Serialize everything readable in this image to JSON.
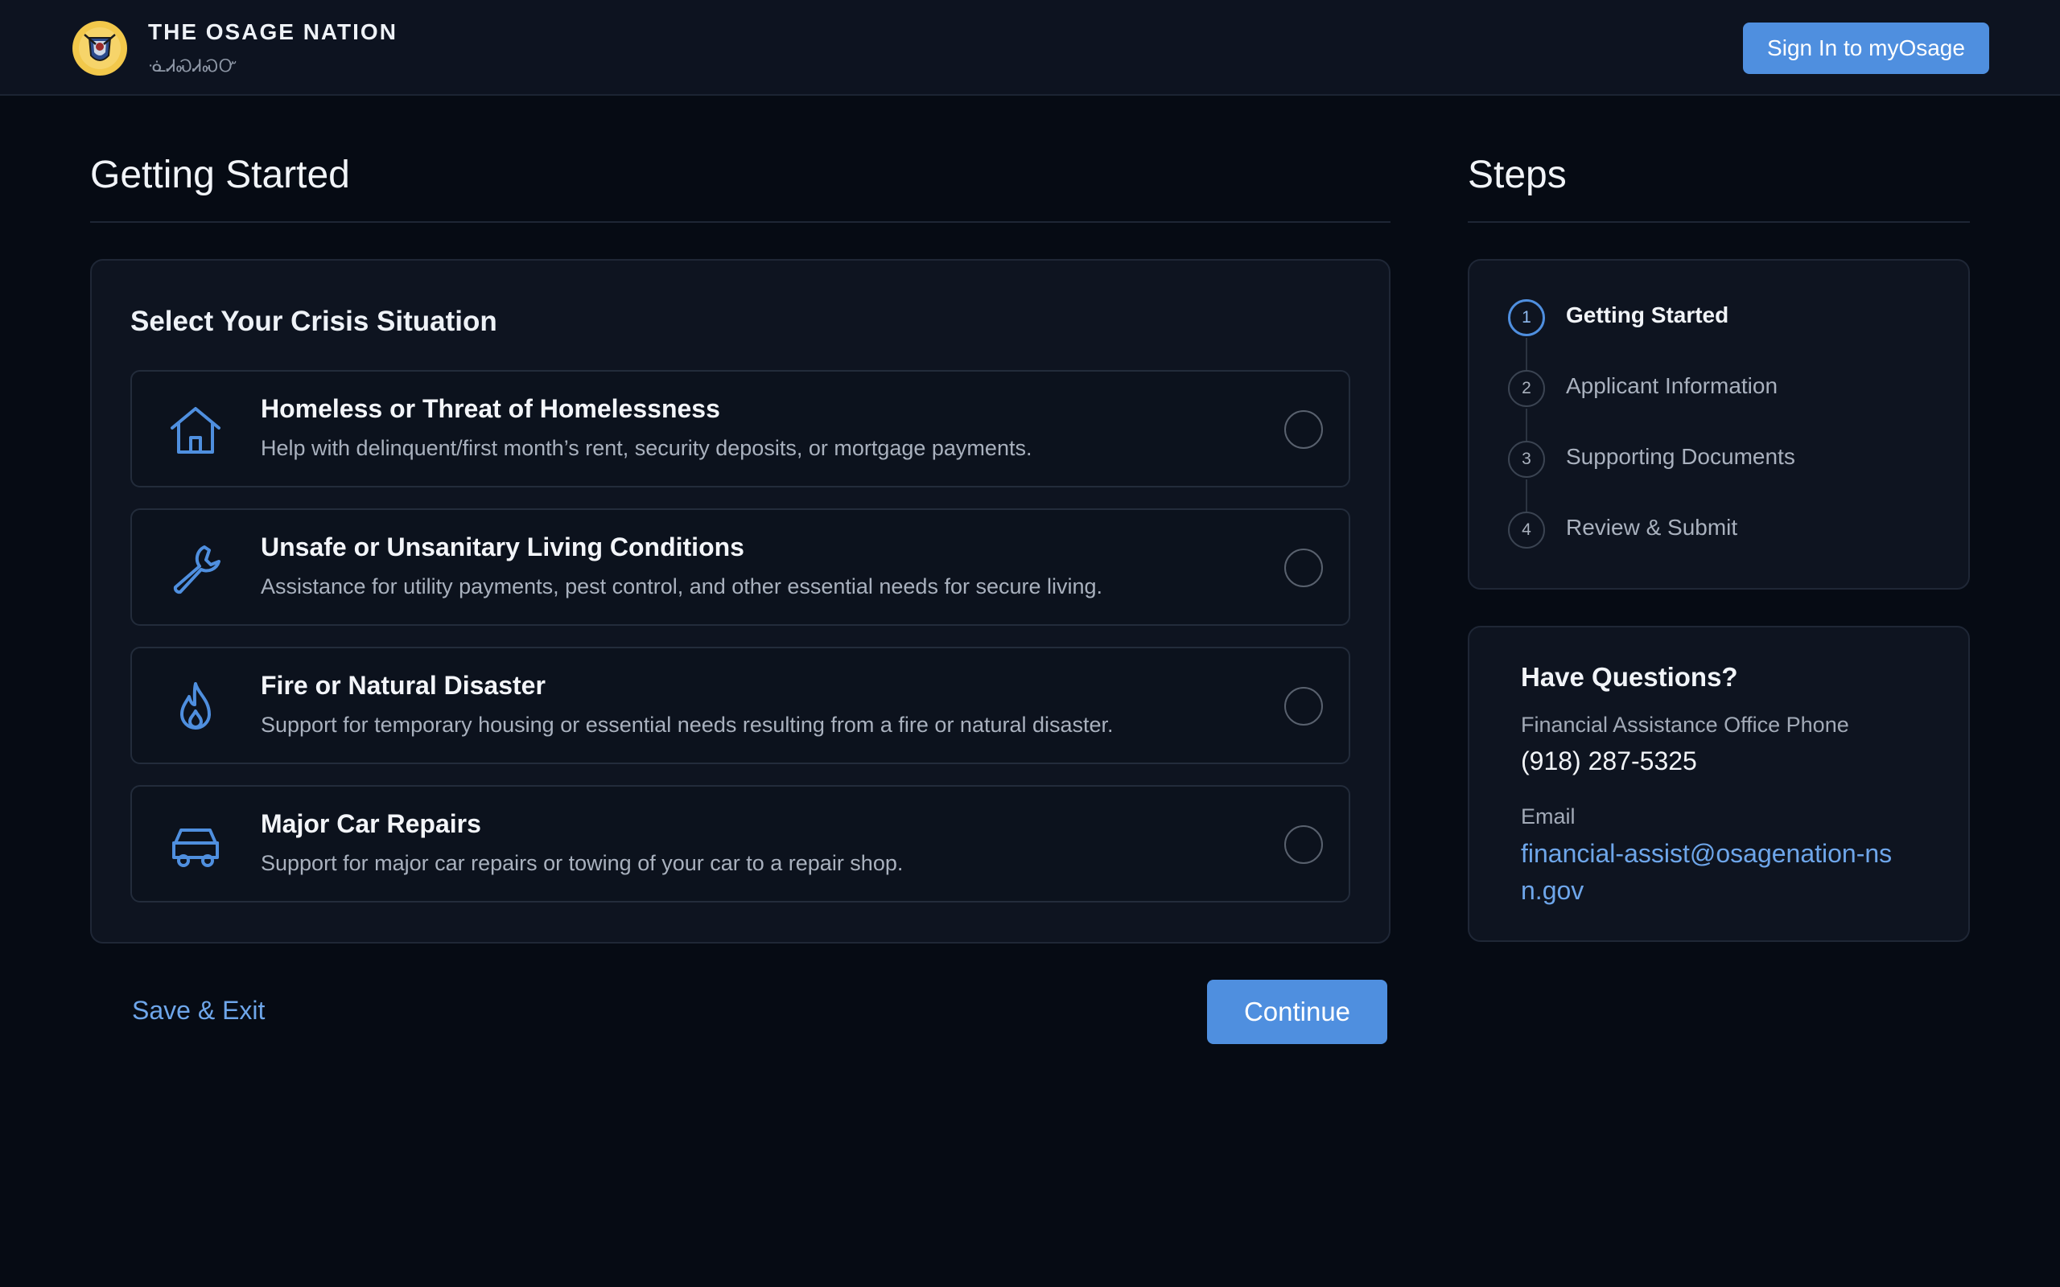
{
  "header": {
    "brand_title": "THE OSAGE NATION",
    "brand_subtitle": "ᓍᏗᏍᏗᏍᏅ",
    "signin_label": "Sign In to myOsage"
  },
  "main": {
    "title": "Getting Started",
    "panel_heading": "Select Your Crisis Situation",
    "options": [
      {
        "icon": "house-icon",
        "title": "Homeless or Threat of Homelessness",
        "description": "Help with delinquent/first month’s rent, security deposits, or mortgage payments.",
        "selected": false
      },
      {
        "icon": "wrench-icon",
        "title": "Unsafe or Unsanitary Living Conditions",
        "description": "Assistance for utility payments, pest control, and other essential needs for secure living.",
        "selected": false
      },
      {
        "icon": "flame-icon",
        "title": "Fire or Natural Disaster",
        "description": "Support for temporary housing or essential needs resulting from a fire or natural disaster.",
        "selected": false
      },
      {
        "icon": "car-icon",
        "title": "Major Car Repairs",
        "description": "Support for major car repairs or towing of your car to a repair shop.",
        "selected": false
      }
    ],
    "save_exit_label": "Save & Exit",
    "continue_label": "Continue"
  },
  "steps": {
    "title": "Steps",
    "items": [
      {
        "number": "1",
        "label": "Getting Started",
        "active": true
      },
      {
        "number": "2",
        "label": "Applicant Information",
        "active": false
      },
      {
        "number": "3",
        "label": "Supporting Documents",
        "active": false
      },
      {
        "number": "4",
        "label": "Review & Submit",
        "active": false
      }
    ]
  },
  "questions": {
    "title": "Have Questions?",
    "phone_label": "Financial Assistance Office Phone",
    "phone": "(918) 287-5325",
    "email_label": "Email",
    "email": "financial-assist@osagenation-nsn.gov"
  },
  "colors": {
    "accent": "#4f8fdf",
    "link": "#6ea6ea",
    "background": "#060b14",
    "panel": "#0e1420",
    "logo_gold": "#f2c84b"
  }
}
